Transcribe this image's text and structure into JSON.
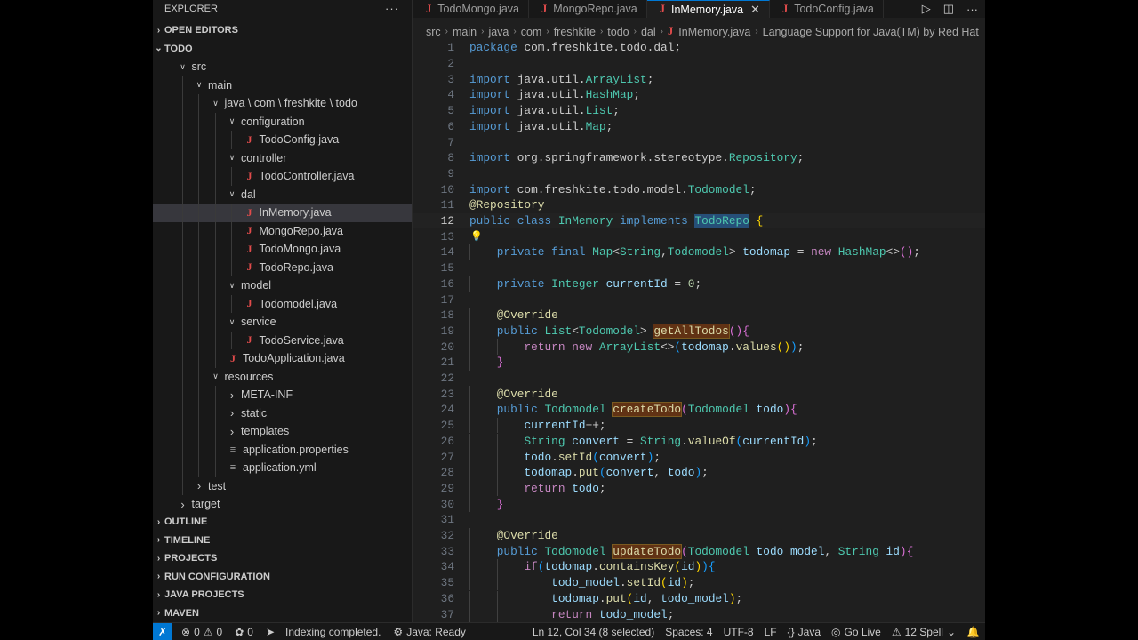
{
  "explorer": {
    "title": "EXPLORER",
    "more": "···",
    "sections": {
      "open_editors": "OPEN EDITORS",
      "todo": "TODO",
      "outline": "OUTLINE",
      "timeline": "TIMELINE",
      "projects": "PROJECTS",
      "run_configuration": "RUN CONFIGURATION",
      "java_projects": "JAVA PROJECTS",
      "maven": "MAVEN"
    },
    "tree": [
      {
        "label": "src",
        "depth": 1,
        "kind": "folder-open"
      },
      {
        "label": "main",
        "depth": 2,
        "kind": "folder-open"
      },
      {
        "label": "java \\ com \\ freshkite \\ todo",
        "depth": 3,
        "kind": "folder-open"
      },
      {
        "label": "configuration",
        "depth": 4,
        "kind": "folder-open"
      },
      {
        "label": "TodoConfig.java",
        "depth": 5,
        "kind": "java"
      },
      {
        "label": "controller",
        "depth": 4,
        "kind": "folder-open"
      },
      {
        "label": "TodoController.java",
        "depth": 5,
        "kind": "java"
      },
      {
        "label": "dal",
        "depth": 4,
        "kind": "folder-open"
      },
      {
        "label": "InMemory.java",
        "depth": 5,
        "kind": "java",
        "active": true
      },
      {
        "label": "MongoRepo.java",
        "depth": 5,
        "kind": "java"
      },
      {
        "label": "TodoMongo.java",
        "depth": 5,
        "kind": "java"
      },
      {
        "label": "TodoRepo.java",
        "depth": 5,
        "kind": "java"
      },
      {
        "label": "model",
        "depth": 4,
        "kind": "folder-open"
      },
      {
        "label": "Todomodel.java",
        "depth": 5,
        "kind": "java"
      },
      {
        "label": "service",
        "depth": 4,
        "kind": "folder-open"
      },
      {
        "label": "TodoService.java",
        "depth": 5,
        "kind": "java"
      },
      {
        "label": "TodoApplication.java",
        "depth": 4,
        "kind": "java"
      },
      {
        "label": "resources",
        "depth": 3,
        "kind": "folder-open"
      },
      {
        "label": "META-INF",
        "depth": 4,
        "kind": "folder"
      },
      {
        "label": "static",
        "depth": 4,
        "kind": "folder"
      },
      {
        "label": "templates",
        "depth": 4,
        "kind": "folder"
      },
      {
        "label": "application.properties",
        "depth": 4,
        "kind": "lines"
      },
      {
        "label": "application.yml",
        "depth": 4,
        "kind": "lines"
      },
      {
        "label": "test",
        "depth": 2,
        "kind": "folder"
      },
      {
        "label": "target",
        "depth": 1,
        "kind": "folder"
      }
    ]
  },
  "tabs": [
    {
      "label": "TodoMongo.java",
      "active": false
    },
    {
      "label": "MongoRepo.java",
      "active": false
    },
    {
      "label": "InMemory.java",
      "active": true
    },
    {
      "label": "TodoConfig.java",
      "active": false
    }
  ],
  "tab_close": "✕",
  "breadcrumb": [
    "src",
    "main",
    "java",
    "com",
    "freshkite",
    "todo",
    "dal",
    "InMemory.java",
    "Language Support for Java(TM) by Red Hat"
  ],
  "editor": {
    "current_line": 12,
    "lines": [
      {
        "n": "1",
        "html": "<span class='kw'>package</span> com.freshkite.todo.dal;"
      },
      {
        "n": "2",
        "html": ""
      },
      {
        "n": "3",
        "html": "<span class='kw'>import</span> java.util.<span class='ty'>ArrayList</span>;"
      },
      {
        "n": "4",
        "html": "<span class='kw'>import</span> java.util.<span class='ty'>HashMap</span>;"
      },
      {
        "n": "5",
        "html": "<span class='kw'>import</span> java.util.<span class='ty'>List</span>;"
      },
      {
        "n": "6",
        "html": "<span class='kw'>import</span> java.util.<span class='ty'>Map</span>;"
      },
      {
        "n": "7",
        "html": ""
      },
      {
        "n": "8",
        "html": "<span class='kw'>import</span> org.springframework.stereotype.<span class='ty'>Repository</span>;"
      },
      {
        "n": "9",
        "html": ""
      },
      {
        "n": "10",
        "html": "<span class='kw'>import</span> com.freshkite.todo.model.<span class='ty'>Todomodel</span>;"
      },
      {
        "n": "11",
        "html": "<span class='ann'>@Repository</span>"
      },
      {
        "n": "12",
        "html": "<span class='kw'>public</span> <span class='kw'>class</span> <span class='ty'>InMemory</span> <span class='kw'>implements</span> <span class='ty sel'>TodoRepo</span> <span class='br1'>{</span>"
      },
      {
        "n": "13",
        "html": ""
      },
      {
        "n": "14",
        "html": "    <span class='kw'>private</span> <span class='kw'>final</span> <span class='ty'>Map</span>&lt;<span class='ty'>String</span>,<span class='ty'>Todomodel</span>&gt; <span class='var'>todomap</span> = <span class='kw2'>new</span> <span class='ty'>HashMap</span>&lt;&gt;<span class='br2'>()</span>;"
      },
      {
        "n": "15",
        "html": ""
      },
      {
        "n": "16",
        "html": "    <span class='kw'>private</span> <span class='ty'>Integer</span> <span class='var'>currentId</span> = <span class='num'>0</span>;"
      },
      {
        "n": "17",
        "html": ""
      },
      {
        "n": "18",
        "html": "    <span class='ann'>@Override</span>"
      },
      {
        "n": "19",
        "html": "    <span class='kw'>public</span> <span class='ty'>List</span>&lt;<span class='ty'>Todomodel</span>&gt; <span class='fn hl'>getAllTodos</span><span class='br2'>()</span><span class='br2'>{</span>"
      },
      {
        "n": "20",
        "html": "        <span class='kw2'>return</span> <span class='kw2'>new</span> <span class='ty'>ArrayList</span>&lt;&gt;<span class='br3'>(</span><span class='var'>todomap</span>.<span class='fn'>values</span><span class='br1'>()</span><span class='br3'>)</span>;"
      },
      {
        "n": "21",
        "html": "    <span class='br2'>}</span>"
      },
      {
        "n": "22",
        "html": ""
      },
      {
        "n": "23",
        "html": "    <span class='ann'>@Override</span>"
      },
      {
        "n": "24",
        "html": "    <span class='kw'>public</span> <span class='ty'>Todomodel</span> <span class='fn hl'>createTodo</span><span class='br2'>(</span><span class='ty'>Todomodel</span> <span class='var'>todo</span><span class='br2'>)</span><span class='br2'>{</span>"
      },
      {
        "n": "25",
        "html": "        <span class='var'>currentId</span>++;"
      },
      {
        "n": "26",
        "html": "        <span class='ty'>String</span> <span class='var'>convert</span> = <span class='ty'>String</span>.<span class='fn'>valueOf</span><span class='br3'>(</span><span class='var'>currentId</span><span class='br3'>)</span>;"
      },
      {
        "n": "27",
        "html": "        <span class='var'>todo</span>.<span class='fn'>setId</span><span class='br3'>(</span><span class='var'>convert</span><span class='br3'>)</span>;"
      },
      {
        "n": "28",
        "html": "        <span class='var'>todomap</span>.<span class='fn'>put</span><span class='br3'>(</span><span class='var'>convert</span>, <span class='var'>todo</span><span class='br3'>)</span>;"
      },
      {
        "n": "29",
        "html": "        <span class='kw2'>return</span> <span class='var'>todo</span>;"
      },
      {
        "n": "30",
        "html": "    <span class='br2'>}</span>"
      },
      {
        "n": "31",
        "html": ""
      },
      {
        "n": "32",
        "html": "    <span class='ann'>@Override</span>"
      },
      {
        "n": "33",
        "html": "    <span class='kw'>public</span> <span class='ty'>Todomodel</span> <span class='fn hl'>updateTodo</span><span class='br2'>(</span><span class='ty'>Todomodel</span> <span class='var'>todo_model</span>, <span class='ty'>String</span> <span class='var'>id</span><span class='br2'>)</span><span class='br2'>{</span>"
      },
      {
        "n": "34",
        "html": "        <span class='kw2'>if</span><span class='br3'>(</span><span class='var'>todomap</span>.<span class='fn'>containsKey</span><span class='br1'>(</span><span class='var'>id</span><span class='br1'>)</span><span class='br3'>)</span><span class='br3'>{</span>"
      },
      {
        "n": "35",
        "html": "            <span class='var'>todo_model</span>.<span class='fn'>setId</span><span class='br1'>(</span><span class='var'>id</span><span class='br1'>)</span>;"
      },
      {
        "n": "36",
        "html": "            <span class='var'>todomap</span>.<span class='fn'>put</span><span class='br1'>(</span><span class='var'>id</span>, <span class='var'>todo_model</span><span class='br1'>)</span>;"
      },
      {
        "n": "37",
        "html": "            <span class='kw2'>return</span> <span class='var'>todo_model</span>;"
      }
    ]
  },
  "status": {
    "errors": "0",
    "warnings": "0",
    "ports": "0",
    "indexing": "Indexing completed.",
    "java_ready": "Java: Ready",
    "cursor": "Ln 12, Col 34 (8 selected)",
    "spaces": "Spaces: 4",
    "encoding": "UTF-8",
    "eol": "LF",
    "language": "Java",
    "go_live": "Go Live",
    "spell": "12 Spell"
  },
  "colors": {
    "accent": "#0078d4",
    "java_icon": "#e04b4b",
    "keyword": "#569cd6",
    "type": "#4ec9b0",
    "function": "#dcdcaa"
  }
}
